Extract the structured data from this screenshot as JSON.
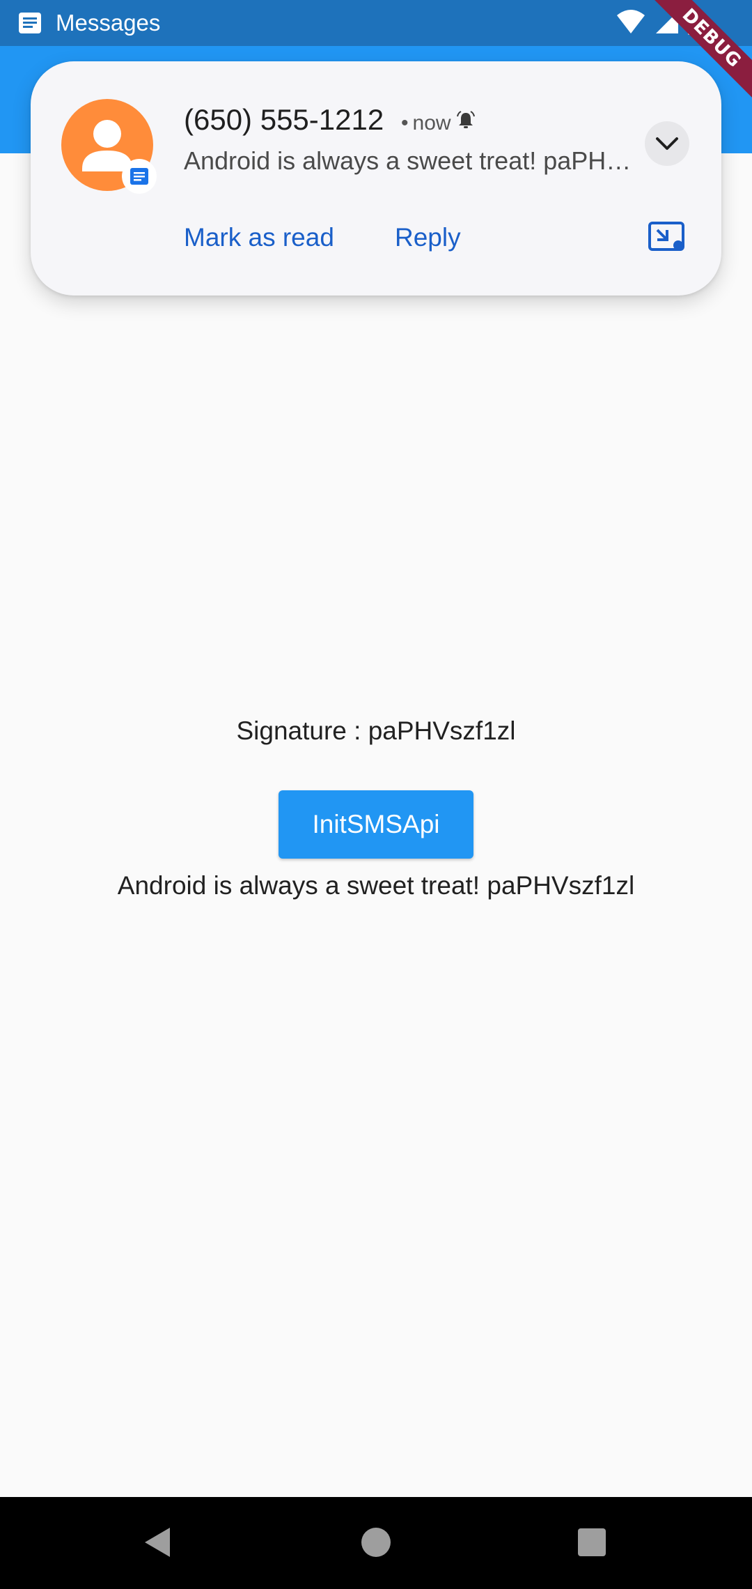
{
  "status_bar": {
    "app_name": "Messages",
    "notification_icon": "messages-icon",
    "icons": [
      "wifi-icon",
      "signal-icon",
      "battery-icon"
    ],
    "color": "#1e72bb"
  },
  "app_bar": {
    "color": "#2196f3"
  },
  "debug_banner": {
    "label": "DEBUG"
  },
  "notification": {
    "sender": "(650) 555-1212",
    "separator": "•",
    "time": "now",
    "alert_icon": "bell-icon",
    "text": "Android is always a sweet treat! paPHVszf1zl",
    "avatar_color": "#ff8c3a",
    "actions": [
      {
        "label": "Mark as read"
      },
      {
        "label": "Reply"
      }
    ],
    "accent_color": "#1a5fc9"
  },
  "main": {
    "signature_text": "Signature : paPHVszf1zl",
    "button_label": "InitSMSApi",
    "message_text": "Android is always a sweet treat! paPHVszf1zl"
  },
  "nav_bar": {
    "icons": [
      "back-icon",
      "home-icon",
      "recents-icon"
    ]
  }
}
